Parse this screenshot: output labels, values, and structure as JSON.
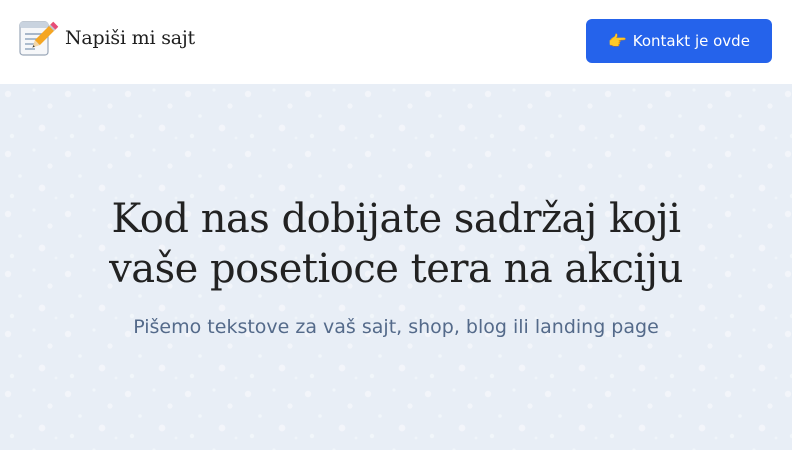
{
  "header": {
    "logo_icon": "memo-pencil-icon",
    "brand_name": "Napiši mi sajt",
    "cta": {
      "icon": "pointing-hand-icon",
      "icon_glyph": "👉",
      "label": "Kontakt je ovde"
    }
  },
  "hero": {
    "title_line1": "Kod nas dobijate sadržaj koji",
    "title_line2": "vaše posetioce tera na akciju",
    "subtitle": "Pišemo tekstove za vaš sajt, shop, blog ili landing page"
  },
  "colors": {
    "accent": "#2563eb",
    "hero_background": "#e8eef6",
    "subtitle": "#546a8a",
    "title": "#222222"
  }
}
